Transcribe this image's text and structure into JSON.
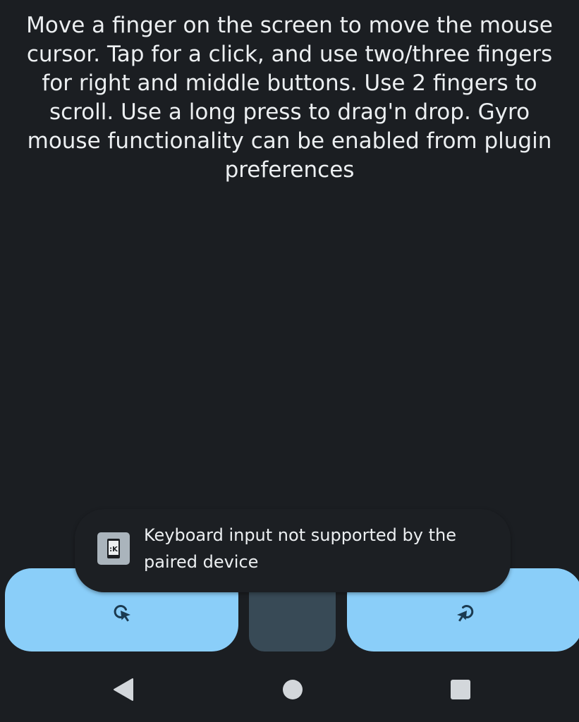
{
  "touchpad": {
    "instructions": "Move a finger on the screen to move the mouse cursor. Tap for a click, and use two/three fingers for right and middle buttons. Use 2 fingers to scroll. Use a long press to drag'n drop. Gyro mouse functionality can be enabled from plugin preferences"
  },
  "toast": {
    "message": "Keyboard input not supported by the paired device",
    "icon": "kde-connect-app-icon"
  },
  "buttons": {
    "left": {
      "icon": "left-click-icon"
    },
    "middle": {
      "icon": "none"
    },
    "right": {
      "icon": "right-click-icon"
    }
  },
  "navbar": {
    "back_icon": "back-triangle-icon",
    "home_icon": "home-circle-icon",
    "recents_icon": "recents-square-icon"
  },
  "colors": {
    "background": "#1b1e22",
    "button_accent": "#8acef9",
    "middle_button": "#384a56",
    "icon_dark": "#1b3a50",
    "nav_icon": "#d3d7db"
  }
}
